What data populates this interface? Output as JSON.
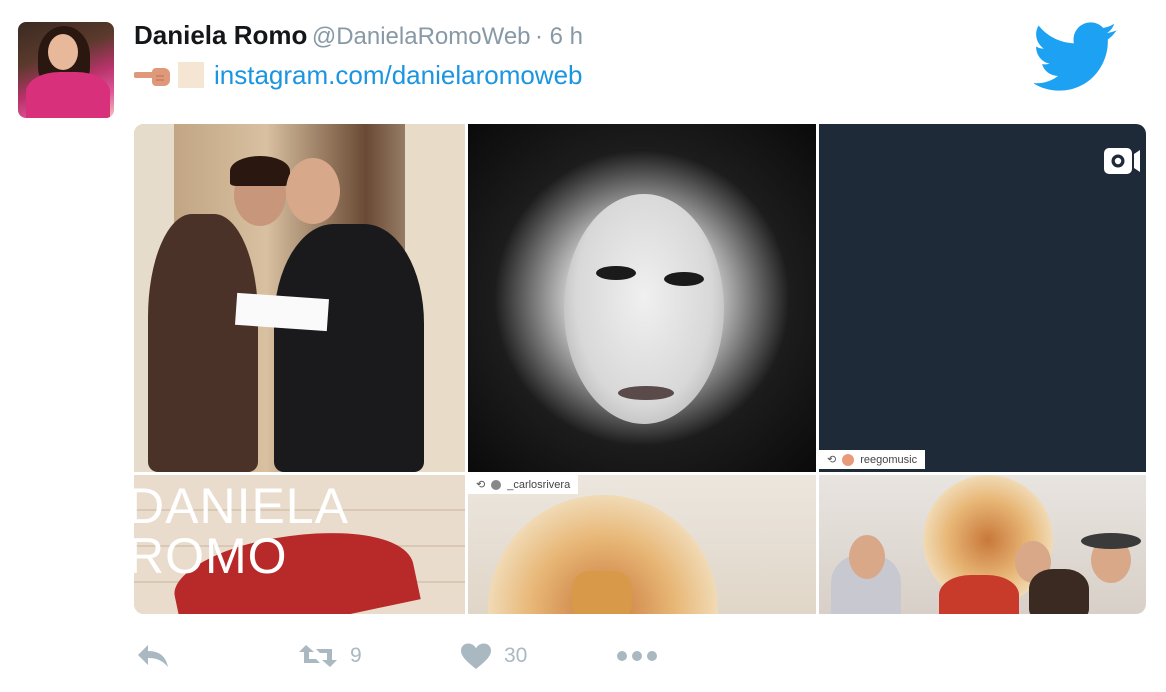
{
  "tweet": {
    "author_name": "Daniela Romo",
    "author_handle": "@DanielaRomoWeb",
    "time": "6 h",
    "link_text": "instagram.com/danielaromoweb"
  },
  "media": {
    "tag_reego": "reegomusic",
    "tag_carlos": "_carlosrivera",
    "cover_text": "DANIELA\nROMO"
  },
  "actions": {
    "retweet_count": "9",
    "like_count": "30"
  },
  "icons": {
    "avatar": "avatar",
    "pointing_hand": "pointing-left-hand-icon",
    "twitter_bird": "twitter-bird-icon",
    "reply": "reply-icon",
    "retweet": "retweet-icon",
    "like": "heart-icon",
    "more": "more-icon",
    "video": "video-camera-icon"
  },
  "colors": {
    "link": "#1b95e0",
    "brand": "#1da1f2",
    "action_gray": "#aab8c2"
  }
}
